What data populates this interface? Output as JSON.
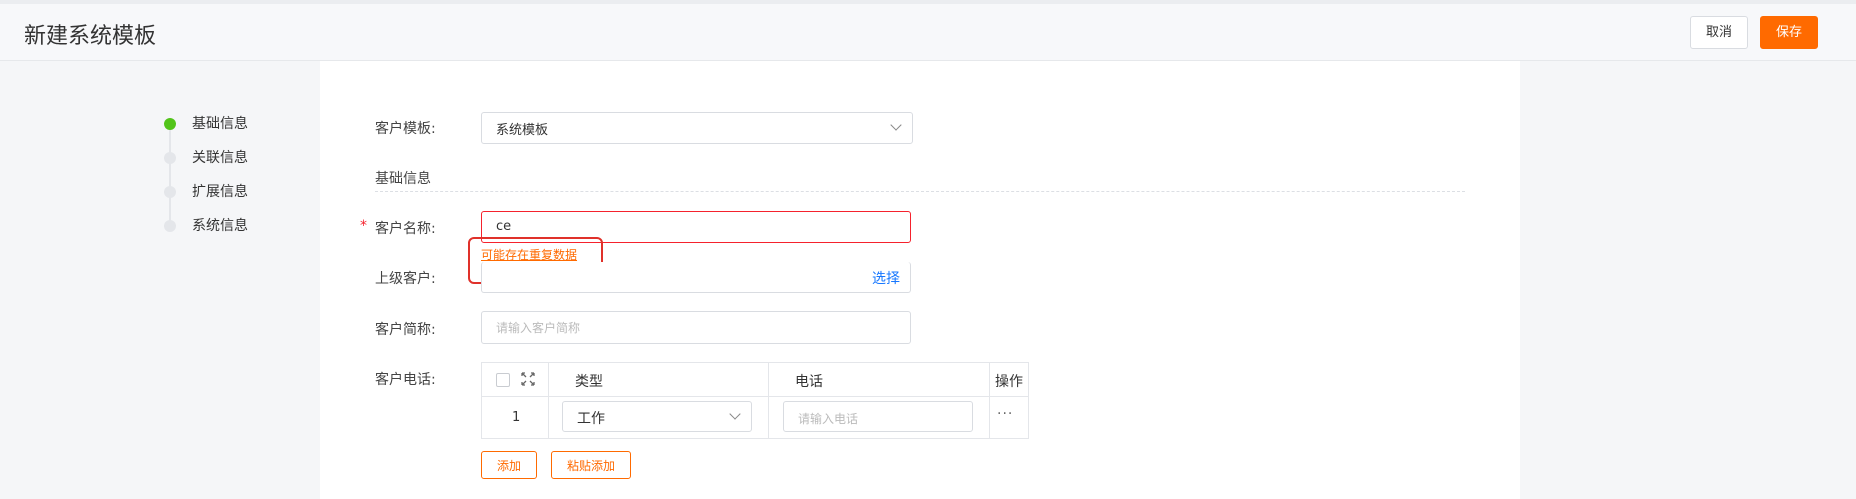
{
  "header": {
    "title": "新建系统模板",
    "cancel_label": "取消",
    "save_label": "保存"
  },
  "steps": [
    {
      "label": "基础信息",
      "active": true
    },
    {
      "label": "关联信息",
      "active": false
    },
    {
      "label": "扩展信息",
      "active": false
    },
    {
      "label": "系统信息",
      "active": false
    }
  ],
  "form": {
    "template_label": "客户模板:",
    "template_value": "系统模板",
    "section_title": "基础信息",
    "required_mark": "*",
    "name_label": "客户名称:",
    "name_value": "ce",
    "duplicate_warning": "可能存在重复数据",
    "parent_label": "上级客户:",
    "parent_select_link": "选择",
    "short_label": "客户简称:",
    "short_placeholder": "请输入客户简称",
    "phone_label": "客户电话:"
  },
  "phone_table": {
    "headers": [
      "类型",
      "电话",
      "操作"
    ],
    "rows": [
      {
        "index": "1",
        "type": "工作",
        "phone_placeholder": "请输入电话",
        "actions": "···"
      }
    ]
  },
  "buttons": {
    "add_label": "添加",
    "paste_add_label": "粘贴添加"
  },
  "colors": {
    "accent": "#ff6a00",
    "active_step": "#52c41a",
    "link": "#1677ff",
    "error": "#f5222d"
  }
}
